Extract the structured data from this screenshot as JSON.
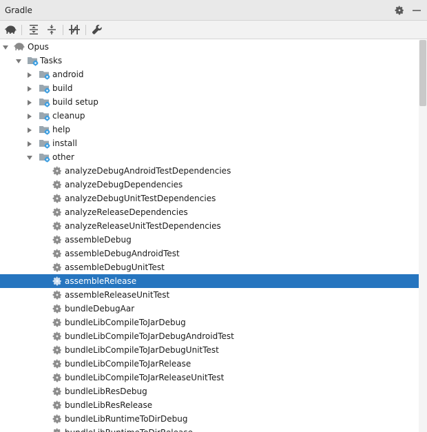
{
  "panel": {
    "title": "Gradle"
  },
  "tree": {
    "root": "Opus",
    "tasks": "Tasks",
    "groups": [
      "android",
      "build",
      "build setup",
      "cleanup",
      "help",
      "install",
      "other"
    ],
    "other_tasks": [
      "analyzeDebugAndroidTestDependencies",
      "analyzeDebugDependencies",
      "analyzeDebugUnitTestDependencies",
      "analyzeReleaseDependencies",
      "analyzeReleaseUnitTestDependencies",
      "assembleDebug",
      "assembleDebugAndroidTest",
      "assembleDebugUnitTest",
      "assembleRelease",
      "assembleReleaseUnitTest",
      "bundleDebugAar",
      "bundleLibCompileToJarDebug",
      "bundleLibCompileToJarDebugAndroidTest",
      "bundleLibCompileToJarDebugUnitTest",
      "bundleLibCompileToJarRelease",
      "bundleLibCompileToJarReleaseUnitTest",
      "bundleLibResDebug",
      "bundleLibResRelease",
      "bundleLibRuntimeToDirDebug",
      "bundleLibRuntimeToDirRelease"
    ],
    "selected_task": "assembleRelease"
  },
  "colors": {
    "selection": "#2675bf",
    "gear": "#8c8c8c",
    "folder": "#9aa7b0",
    "gear_badge": "#3d9ee0"
  },
  "icons": {
    "root": "elephant-icon",
    "task": "gear-icon",
    "group": "folder-gear-icon",
    "toolbar": [
      "elephant-icon",
      "expand-all-icon",
      "collapse-all-icon",
      "toggle-offline-icon",
      "wrench-icon"
    ],
    "titlebar": [
      "gear-icon",
      "minimize-icon"
    ]
  }
}
